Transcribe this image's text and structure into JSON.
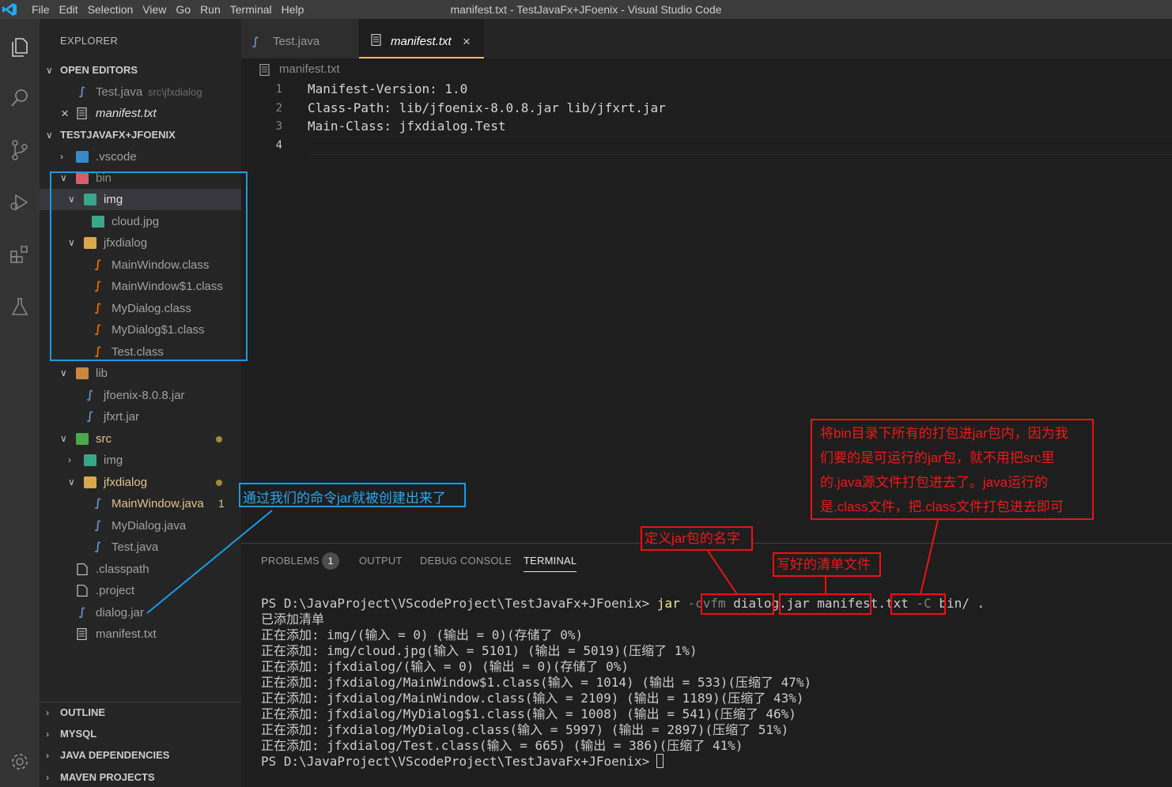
{
  "titlebar": {
    "menu": [
      "File",
      "Edit",
      "Selection",
      "View",
      "Go",
      "Run",
      "Terminal",
      "Help"
    ],
    "window_title": "manifest.txt - TestJavaFx+JFoenix - Visual Studio Code"
  },
  "sidebar": {
    "title": "EXPLORER",
    "open_editors": {
      "label": "OPEN EDITORS",
      "items": [
        {
          "name": "Test.java",
          "hint": "src\\jfxdialog"
        },
        {
          "name": "manifest.txt",
          "close": "×"
        }
      ]
    },
    "project": {
      "label": "TESTJAVAFX+JFOENIX",
      "tree": {
        "vscode": ".vscode",
        "bin": "bin",
        "bin_img": "img",
        "cloud": "cloud.jpg",
        "bin_jfxdialog": "jfxdialog",
        "c1": "MainWindow.class",
        "c2": "MainWindow$1.class",
        "c3": "MyDialog.class",
        "c4": "MyDialog$1.class",
        "c5": "Test.class",
        "lib": "lib",
        "jar1": "jfoenix-8.0.8.jar",
        "jar2": "jfxrt.jar",
        "src": "src",
        "src_img": "img",
        "src_jfxdialog": "jfxdialog",
        "j1": "MainWindow.java",
        "j1_badge": "1",
        "j2": "MyDialog.java",
        "j3": "Test.java",
        "classpath": ".classpath",
        "project": ".project",
        "dialogjar": "dialog.jar",
        "manifest": "manifest.txt"
      }
    },
    "sections": [
      "OUTLINE",
      "MYSQL",
      "JAVA DEPENDENCIES",
      "MAVEN PROJECTS"
    ]
  },
  "tabs": [
    {
      "label": "Test.java"
    },
    {
      "label": "manifest.txt",
      "close": "×"
    }
  ],
  "breadcrumb": "manifest.txt",
  "editor": {
    "lines": [
      {
        "n": "1",
        "text": "Manifest-Version: 1.0"
      },
      {
        "n": "2",
        "text": "Class-Path: lib/jfoenix-8.0.8.jar lib/jfxrt.jar"
      },
      {
        "n": "3",
        "text": "Main-Class: jfxdialog.Test"
      },
      {
        "n": "4",
        "text": ""
      }
    ]
  },
  "panel": {
    "tabs": [
      "PROBLEMS",
      "OUTPUT",
      "DEBUG CONSOLE",
      "TERMINAL"
    ],
    "problems_count": "1",
    "terminal": {
      "prompt": "PS D:\\JavaProject\\VScodeProject\\TestJavaFx+JFoenix>",
      "cmd": "jar",
      "flag": "-cvfm",
      "jarname": "dialog.jar",
      "manifest": "manifest.txt",
      "cflag": "-C",
      "target": "bin/ .",
      "lines": [
        "已添加清单",
        "正在添加: img/(输入 = 0) (输出 = 0)(存储了 0%)",
        "正在添加: img/cloud.jpg(输入 = 5101) (输出 = 5019)(压缩了 1%)",
        "正在添加: jfxdialog/(输入 = 0) (输出 = 0)(存储了 0%)",
        "正在添加: jfxdialog/MainWindow$1.class(输入 = 1014) (输出 = 533)(压缩了 47%)",
        "正在添加: jfxdialog/MainWindow.class(输入 = 2109) (输出 = 1189)(压缩了 43%)",
        "正在添加: jfxdialog/MyDialog$1.class(输入 = 1008) (输出 = 541)(压缩了 46%)",
        "正在添加: jfxdialog/MyDialog.class(输入 = 5997) (输出 = 2897)(压缩了 51%)",
        "正在添加: jfxdialog/Test.class(输入 = 665) (输出 = 386)(压缩了 41%)"
      ],
      "final_prompt": "PS D:\\JavaProject\\VScodeProject\\TestJavaFx+JFoenix>"
    }
  },
  "annotations": {
    "jar_created": "通过我们的命令jar就被创建出来了",
    "jar_name": "定义jar包的名字",
    "manifest_file": "写好的清单文件",
    "bin_note": [
      "将bin目录下所有的打包进jar包内，因为我",
      "们要的是可运行的jar包，就不用把src里",
      "的.java源文件打包进去了。java运行的",
      "是.class文件，把.class文件打包进去即可"
    ]
  },
  "colors": {
    "accent": "#e7c06b",
    "annotation_red": "#ee1111",
    "annotation_blue": "#1a9ae6",
    "modified": "#e2c08d"
  }
}
